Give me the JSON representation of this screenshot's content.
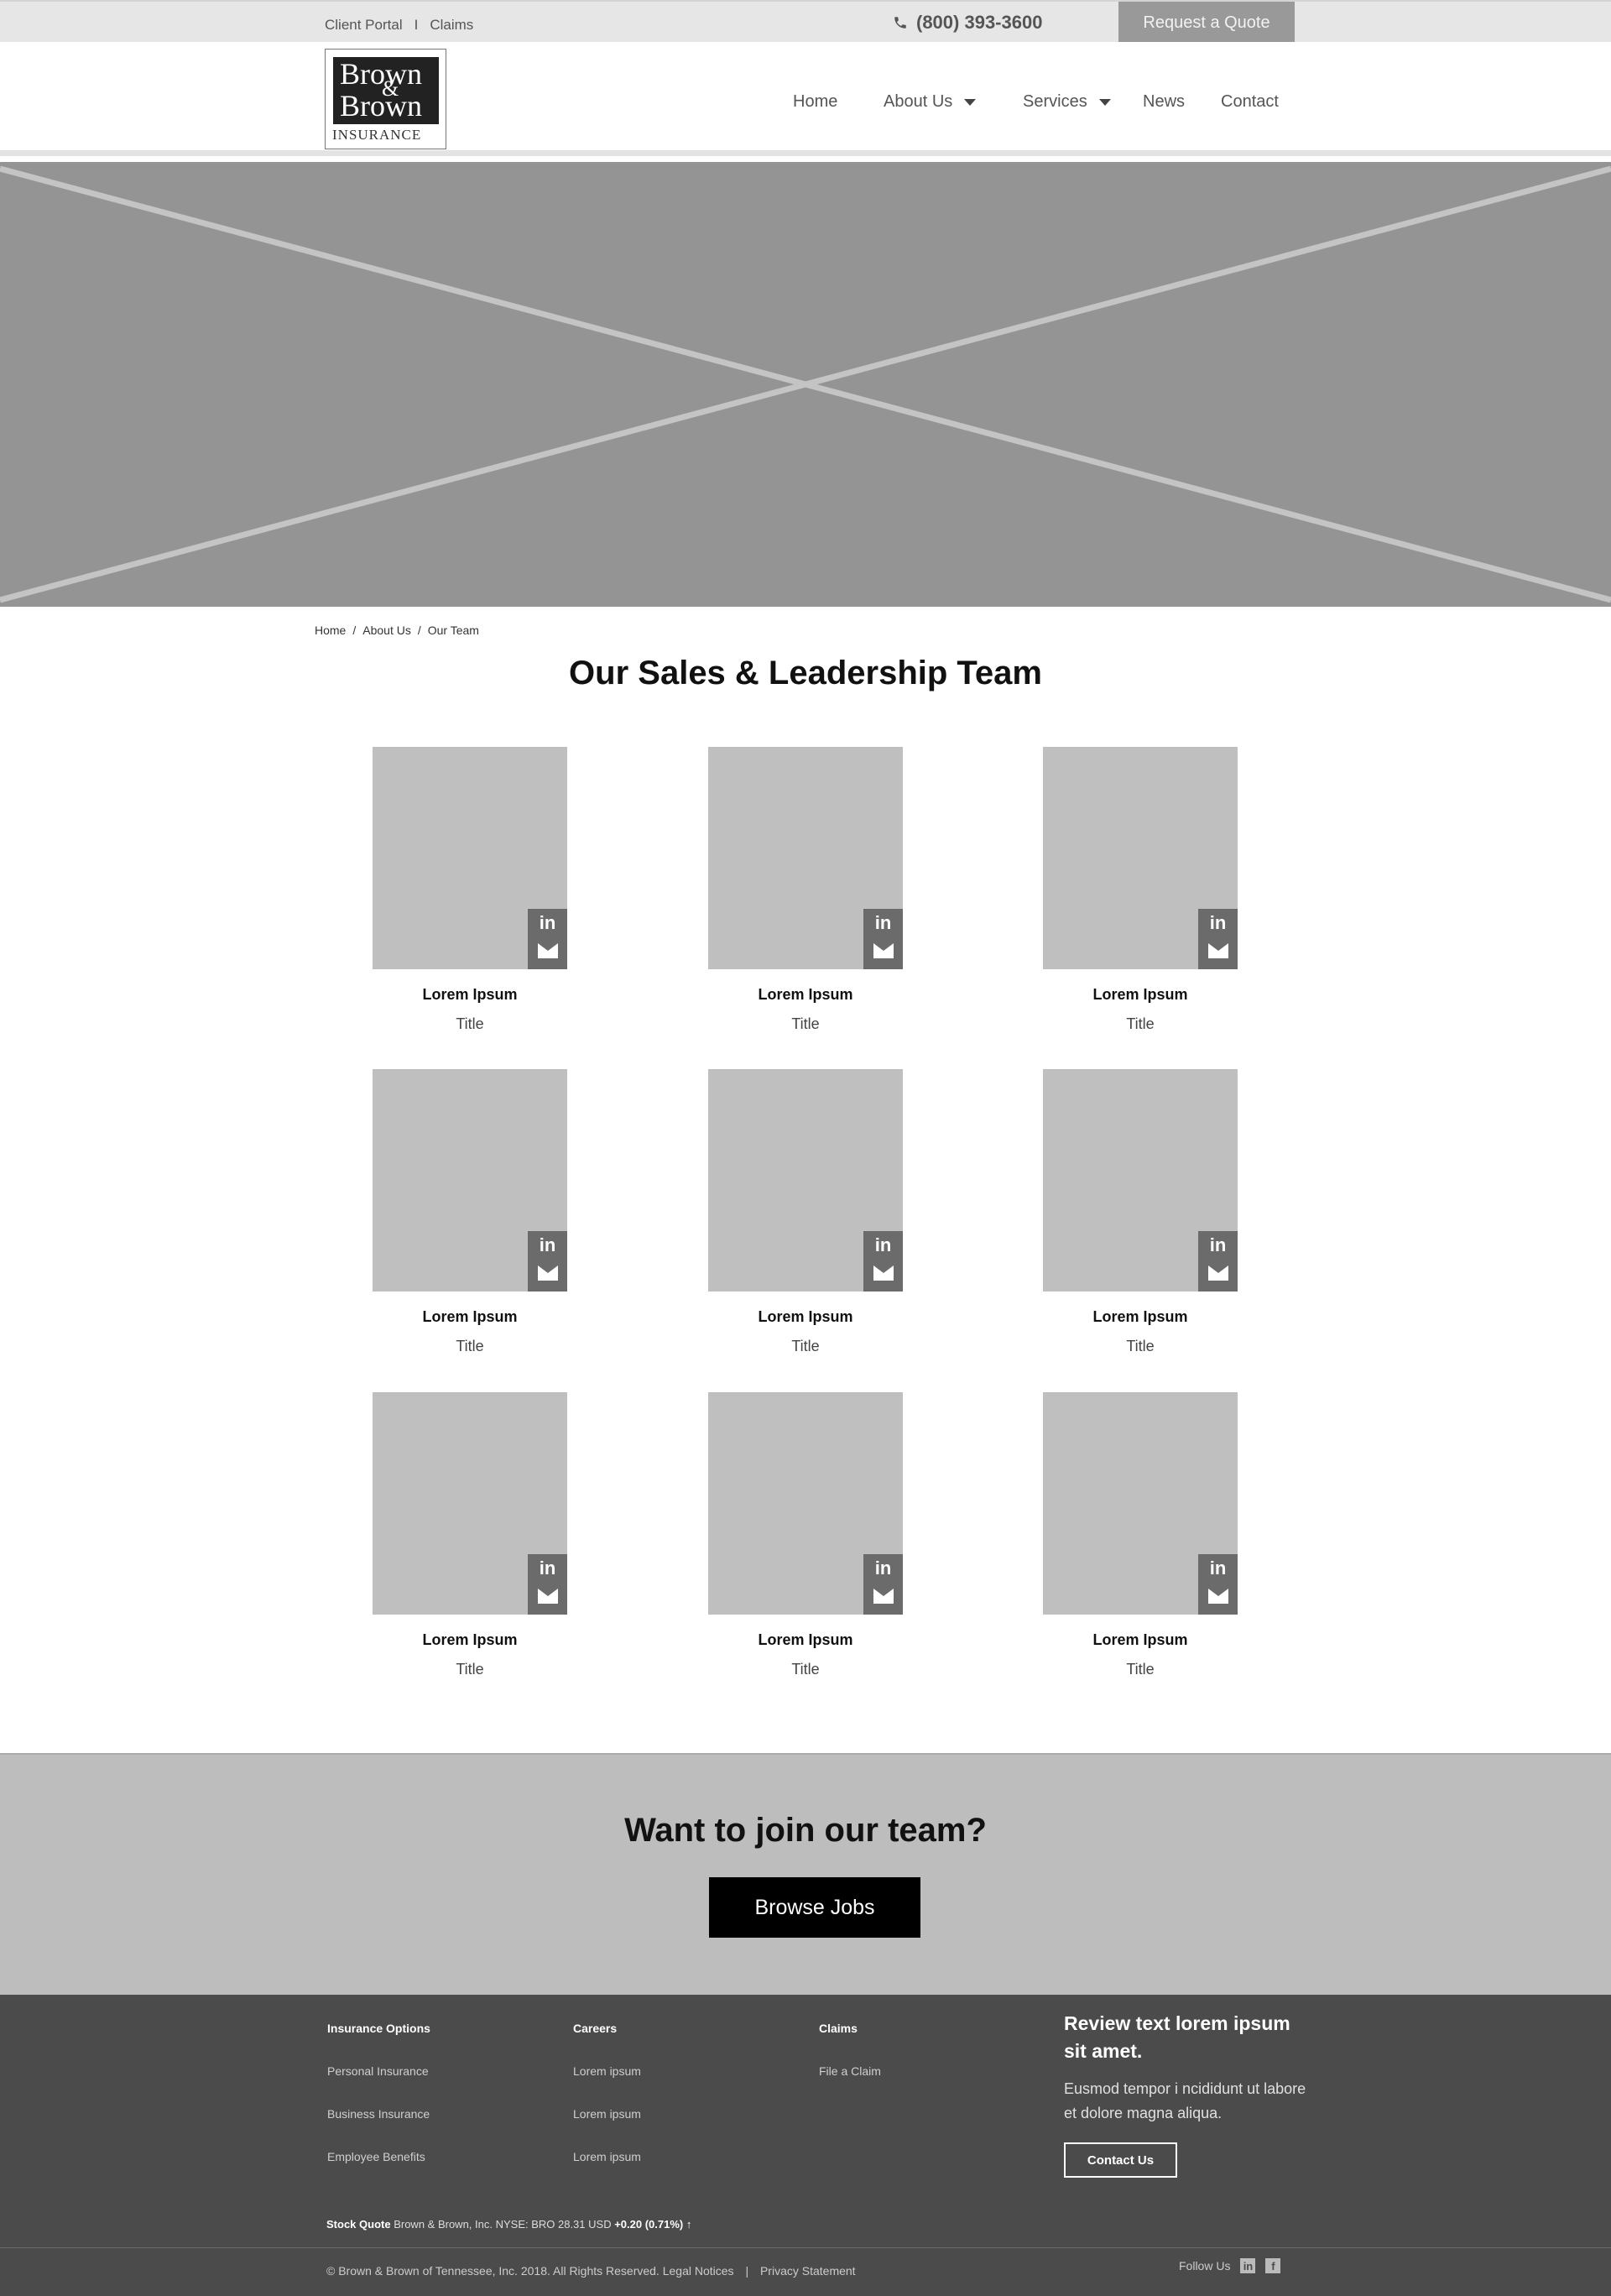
{
  "topbar": {
    "client_portal": "Client Portal",
    "separator": "I",
    "claims": "Claims",
    "phone": "(800) 393-3600",
    "phone_icon": "phone-icon",
    "quote_button": "Request a Quote"
  },
  "logo": {
    "line1": "Brown",
    "amp": "&",
    "line2": "Brown",
    "line3": "INSURANCE"
  },
  "nav": {
    "home": "Home",
    "about": "About Us",
    "services": "Services",
    "news": "News",
    "contact": "Contact"
  },
  "breadcrumb": {
    "home": "Home",
    "sep": "/",
    "about": "About Us",
    "current": "Our Team"
  },
  "page_title": "Our Sales & Leadership Team",
  "team": [
    {
      "name": "Lorem Ipsum",
      "title": "Title"
    },
    {
      "name": "Lorem Ipsum",
      "title": "Title"
    },
    {
      "name": "Lorem Ipsum",
      "title": "Title"
    },
    {
      "name": "Lorem Ipsum",
      "title": "Title"
    },
    {
      "name": "Lorem Ipsum",
      "title": "Title"
    },
    {
      "name": "Lorem Ipsum",
      "title": "Title"
    },
    {
      "name": "Lorem Ipsum",
      "title": "Title"
    },
    {
      "name": "Lorem Ipsum",
      "title": "Title"
    },
    {
      "name": "Lorem Ipsum",
      "title": "Title"
    }
  ],
  "social": {
    "linkedin": "in"
  },
  "join": {
    "heading": "Want to join our team?",
    "button": "Browse Jobs"
  },
  "footer": {
    "col1": {
      "head": "Insurance Options",
      "items": [
        "Personal Insurance",
        "Business Insurance",
        "Employee Benefits"
      ]
    },
    "col2": {
      "head": "Careers",
      "items": [
        "Lorem ipsum",
        "Lorem ipsum",
        "Lorem ipsum"
      ]
    },
    "col3": {
      "head": "Claims",
      "items": [
        "File a Claim"
      ]
    },
    "review": {
      "heading": "Review text lorem ipsum sit amet.",
      "text": "Eusmod tempor i ncididunt ut labore et dolore magna aliqua.",
      "button": "Contact Us"
    },
    "stock_label": "Stock Quote",
    "stock_text": "Brown & Brown, Inc. NYSE: BRO 28.31 USD",
    "stock_change": "+0.20 (0.71%)",
    "copyright": "© Brown & Brown of Tennessee, Inc. 2018. All Rights Reserved. Legal Notices",
    "privacy": "Privacy Statement",
    "follow": "Follow Us",
    "linkedin": "in",
    "facebook": "f"
  }
}
